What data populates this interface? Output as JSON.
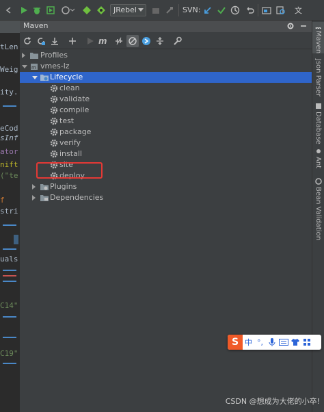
{
  "toolbar": {
    "jrebel_select_value": "JRebel",
    "svn_label": "SVN:",
    "icons": [
      "run-icon",
      "debug-icon",
      "coverage-icon",
      "profile-icon",
      "jrebel-run-icon",
      "jrebel-debug-icon",
      "build-icon",
      "stop-icon",
      "svn-update-icon",
      "svn-commit-icon",
      "history-icon",
      "revert-icon",
      "project-structure-icon",
      "search-icon",
      "translate-icon"
    ]
  },
  "editor": {
    "lines": [
      "tLen",
      "Weig",
      "ity.",
      "eCod",
      "sInf",
      "ator",
      "nift",
      "(\"te",
      "f",
      "stri",
      "uals",
      "C14\"",
      "C19\""
    ]
  },
  "maven": {
    "title": "Maven",
    "toolbar_icons": [
      "reload-icon",
      "reimport-icon",
      "download-icon",
      "add-icon",
      "run-icon",
      "maven-goal-icon",
      "toggle-offline-icon",
      "skip-tests-icon",
      "show-dependencies-icon",
      "collapse-all-icon",
      "settings-wrench-icon"
    ],
    "tree": {
      "profiles": "Profiles",
      "project": "vmes-lz",
      "lifecycle": "Lifecycle",
      "goals": [
        "clean",
        "validate",
        "compile",
        "test",
        "package",
        "verify",
        "install",
        "site",
        "deploy"
      ],
      "plugins": "Plugins",
      "dependencies": "Dependencies"
    }
  },
  "right_tabs": [
    "Maven",
    "Json Parser",
    "Database",
    "Ant",
    "Bean Validation"
  ],
  "ime": {
    "logo": "S",
    "items": [
      "中",
      "°,",
      "mic",
      "keyboard",
      "shirt",
      "grid"
    ]
  },
  "watermark": "CSDN @想成为大佬的小卒!",
  "colors": {
    "selection": "#2f65ca",
    "highlight_box": "#e53935",
    "accent_blue": "#4a88c7"
  }
}
